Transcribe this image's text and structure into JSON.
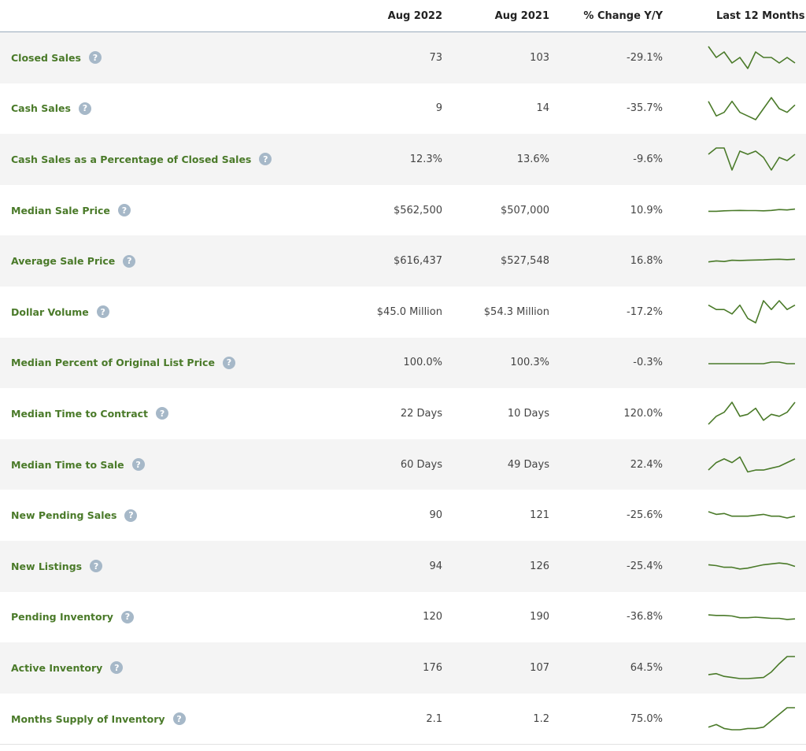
{
  "header": {
    "col_aug2022": "Aug 2022",
    "col_aug2021": "Aug 2021",
    "col_pct": "% Change Y/Y",
    "col_last12": "Last 12 Months"
  },
  "rows": [
    {
      "label": "Closed Sales",
      "aug2022": "73",
      "aug2021": "103",
      "pct": "-29.1%",
      "trend": [
        7,
        5,
        6,
        4,
        5,
        3,
        6,
        5,
        5,
        4,
        5,
        4
      ]
    },
    {
      "label": "Cash Sales",
      "aug2022": "9",
      "aug2021": "14",
      "pct": "-35.7%",
      "trend": [
        9,
        5,
        6,
        9,
        6,
        5,
        4,
        7,
        10,
        7,
        6,
        8
      ]
    },
    {
      "label": "Cash Sales as a Percentage of Closed Sales",
      "aug2022": "12.3%",
      "aug2021": "13.6%",
      "pct": "-9.6%",
      "trend": [
        9,
        11,
        11,
        4,
        10,
        9,
        10,
        8,
        4,
        8,
        7,
        9
      ]
    },
    {
      "label": "Median Sale Price",
      "aug2022": "$562,500",
      "aug2021": "$507,000",
      "pct": "10.9%",
      "trend": [
        500,
        500,
        502,
        503,
        504,
        503,
        503,
        502,
        504,
        508,
        506,
        510
      ]
    },
    {
      "label": "Average Sale Price",
      "aug2022": "$616,437",
      "aug2021": "$527,548",
      "pct": "16.8%",
      "trend": [
        520,
        525,
        522,
        528,
        527,
        528,
        529,
        530,
        532,
        533,
        531,
        533
      ]
    },
    {
      "label": "Dollar Volume",
      "aug2022": "$45.0 Million",
      "aug2021": "$54.3 Million",
      "pct": "-17.2%",
      "trend": [
        6,
        5,
        5,
        4,
        6,
        3,
        2,
        7,
        5,
        7,
        5,
        6
      ]
    },
    {
      "label": "Median Percent of Original List Price",
      "aug2022": "100.0%",
      "aug2021": "100.3%",
      "pct": "-0.3%",
      "trend": [
        100,
        100,
        100,
        100,
        100,
        100,
        100,
        100,
        100.05,
        100.05,
        100,
        100
      ]
    },
    {
      "label": "Median Time to Contract",
      "aug2022": "22 Days",
      "aug2021": "10 Days",
      "pct": "120.0%",
      "trend": [
        10,
        14,
        16,
        21,
        14,
        15,
        18,
        12,
        15,
        14,
        16,
        21
      ]
    },
    {
      "label": "Median Time to Sale",
      "aug2022": "60 Days",
      "aug2021": "49 Days",
      "pct": "22.4%",
      "trend": [
        52,
        56,
        58,
        56,
        59,
        51,
        52,
        52,
        53,
        54,
        56,
        58
      ]
    },
    {
      "label": "New Pending Sales",
      "aug2022": "90",
      "aug2021": "121",
      "pct": "-25.6%",
      "trend": [
        121,
        118,
        119,
        116,
        116,
        116,
        117,
        118,
        116,
        116,
        114,
        116
      ]
    },
    {
      "label": "New Listings",
      "aug2022": "94",
      "aug2021": "126",
      "pct": "-25.4%",
      "trend": [
        126,
        125,
        123,
        123,
        121,
        122,
        124,
        126,
        127,
        128,
        127,
        124
      ]
    },
    {
      "label": "Pending Inventory",
      "aug2022": "120",
      "aug2021": "190",
      "pct": "-36.8%",
      "trend": [
        190,
        189,
        189,
        188,
        185,
        185,
        186,
        185,
        184,
        184,
        182,
        183
      ]
    },
    {
      "label": "Active Inventory",
      "aug2022": "176",
      "aug2021": "107",
      "pct": "64.5%",
      "trend": [
        107,
        109,
        104,
        102,
        100,
        100,
        101,
        102,
        112,
        127,
        140,
        140
      ]
    },
    {
      "label": "Months Supply of Inventory",
      "aug2022": "2.1",
      "aug2021": "1.2",
      "pct": "75.0%",
      "trend": [
        1.2,
        1.3,
        1.15,
        1.1,
        1.1,
        1.15,
        1.15,
        1.2,
        1.45,
        1.7,
        1.95,
        1.95
      ]
    }
  ]
}
